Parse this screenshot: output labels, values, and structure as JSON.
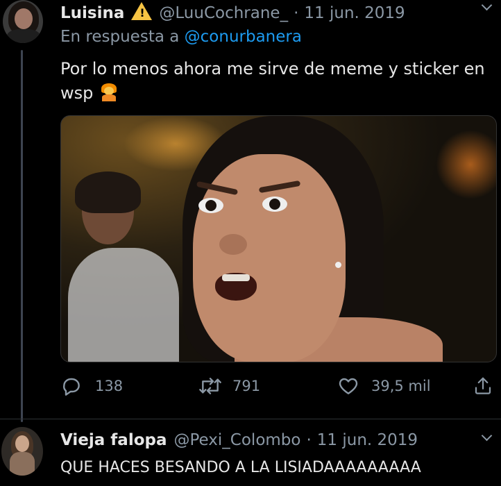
{
  "tweet1": {
    "display_name": "Luisina",
    "handle": "@LuuCochrane_",
    "separator": "·",
    "date": "11 jun. 2019",
    "reply_prefix": "En respuesta a",
    "reply_mention": "@conurbanera",
    "text": "Por lo menos ahora me sirve de meme y sticker en wsp",
    "badge_icon": "warning-icon",
    "emoji_icon": "person-emoji-icon",
    "actions": {
      "reply_count": "138",
      "retweet_count": "791",
      "like_count": "39,5 mil"
    }
  },
  "tweet2": {
    "display_name": "Vieja falopa",
    "handle": "@Pexi_Colombo",
    "separator": "·",
    "date": "11 jun. 2019",
    "text": "QUE HACES BESANDO A LA LISIADAAAAAAAAA"
  },
  "colors": {
    "background": "#000000",
    "text_primary": "#e7e7e7",
    "text_secondary": "#8b98a5",
    "link": "#1d9bf0",
    "warning": "#f6c343"
  }
}
